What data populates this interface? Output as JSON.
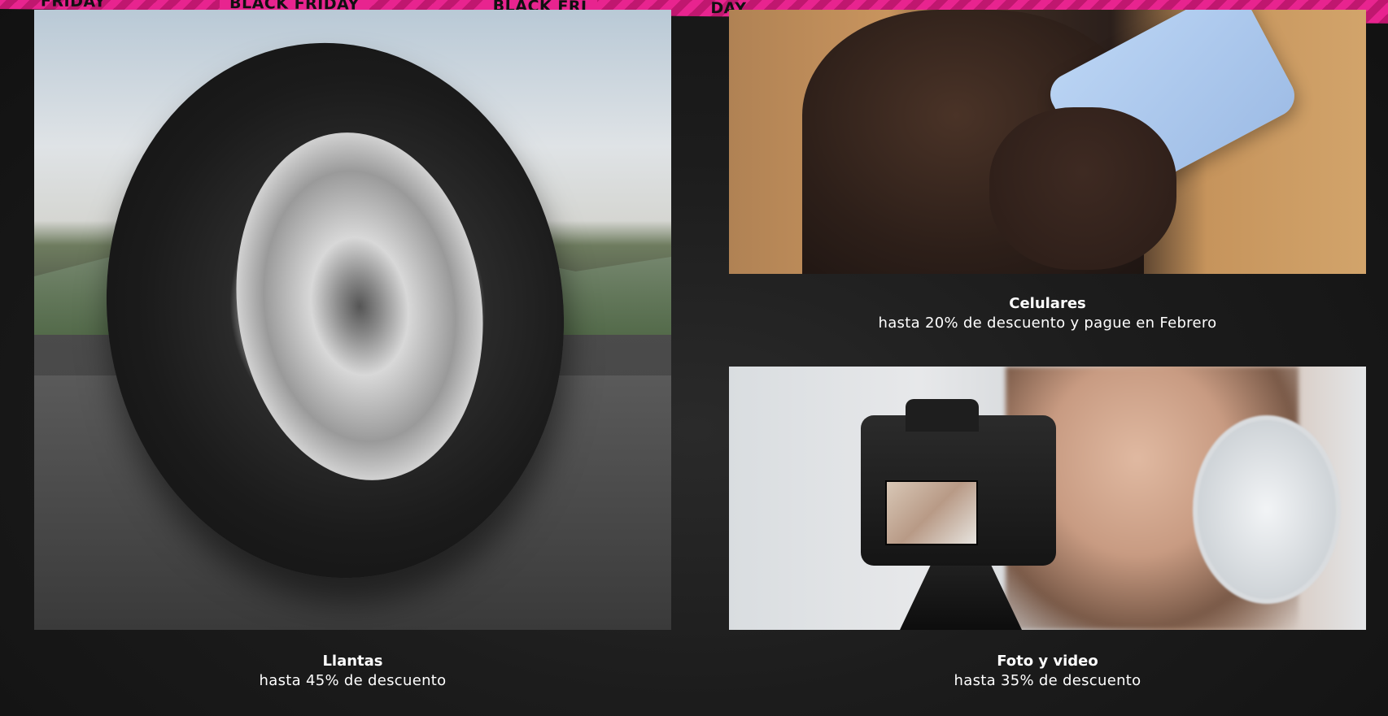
{
  "banner": {
    "left_text": "FRIDAY",
    "center_text": "BLACK FRIDAY",
    "right_text": "BLACK FRI",
    "far_right_text": "DAY",
    "accent_color": "#e8248f"
  },
  "categories": [
    {
      "id": "tires",
      "title": "Llantas",
      "subtitle": "hasta 45% de descuento"
    },
    {
      "id": "phones",
      "title": "Celulares",
      "subtitle": "hasta 20% de descuento y pague en Febrero"
    },
    {
      "id": "camera",
      "title": "Foto y video",
      "subtitle": "hasta 35% de descuento"
    }
  ]
}
